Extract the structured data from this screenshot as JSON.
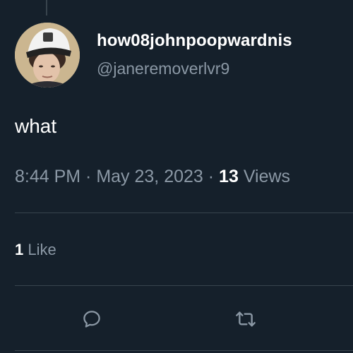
{
  "tweet": {
    "author": {
      "display_name": "how08johnpoopwardnis",
      "handle": "@janeremoverlvr9"
    },
    "text": "what",
    "time": "8:44 PM",
    "date": "May 23, 2023",
    "views_count": "13",
    "views_label": "Views",
    "likes_count": "1",
    "likes_label": "Like"
  },
  "icons": {
    "reply": "reply-icon",
    "retweet": "retweet-icon"
  },
  "colors": {
    "background": "#15202b",
    "divider": "#38444d",
    "primary_text": "#ffffff",
    "secondary_text": "#8b98a5"
  }
}
